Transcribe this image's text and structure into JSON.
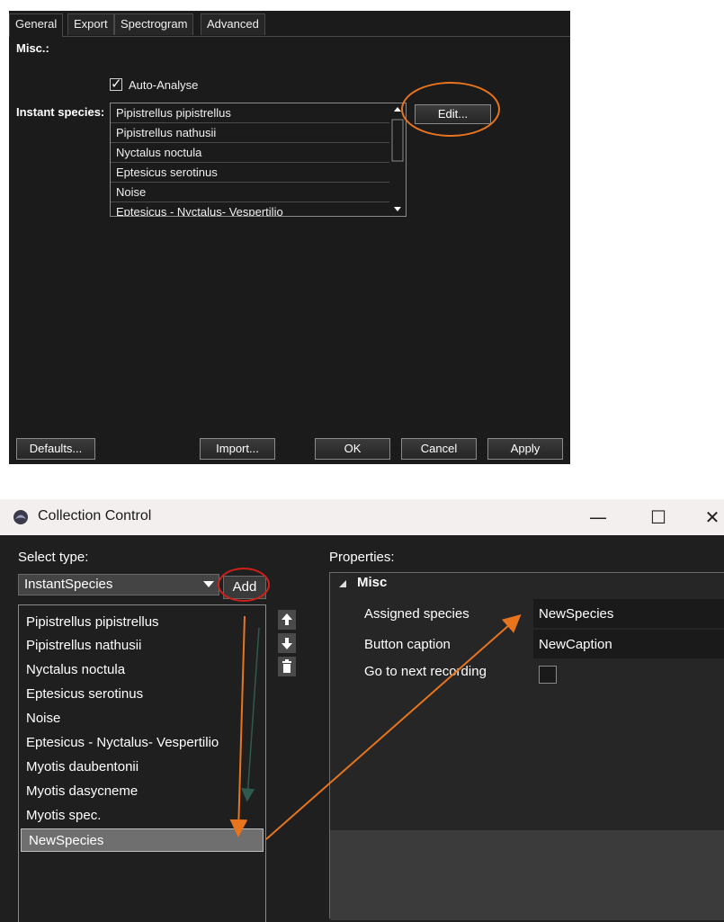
{
  "settings": {
    "tabs": [
      "General",
      "Export",
      "Spectrogram",
      "Advanced"
    ],
    "misc_label": "Misc.:",
    "auto_analyse": {
      "label": "Auto-Analyse",
      "checked": true
    },
    "instant_species_label": "Instant species:",
    "species": [
      "Pipistrellus pipistrellus",
      "Pipistrellus nathusii",
      "Nyctalus noctula",
      "Eptesicus serotinus",
      "Noise",
      "Eptesicus - Nyctalus- Vespertilio"
    ],
    "edit_button": "Edit...",
    "footer": {
      "defaults": "Defaults...",
      "import": "Import...",
      "ok": "OK",
      "cancel": "Cancel",
      "apply": "Apply"
    }
  },
  "collection": {
    "title": "Collection Control",
    "window_controls": {
      "minimize": "—",
      "maximize": "☐",
      "close": "✕"
    },
    "select_type_label": "Select type:",
    "type_value": "InstantSpecies",
    "add_button": "Add",
    "items": [
      "Pipistrellus pipistrellus",
      "Pipistrellus nathusii",
      "Nyctalus noctula",
      "Eptesicus serotinus",
      "Noise",
      "Eptesicus - Nyctalus- Vespertilio",
      "Myotis daubentonii",
      "Myotis dasycneme",
      "Myotis spec.",
      "NewSpecies"
    ],
    "selected_item": "NewSpecies",
    "properties_label": "Properties:",
    "category": "Misc",
    "properties": [
      {
        "name": "Assigned species",
        "value": "NewSpecies"
      },
      {
        "name": "Button caption",
        "value": "NewCaption"
      },
      {
        "name": "Go to next recording",
        "value": ""
      }
    ]
  },
  "colors": {
    "annotation_orange": "#e8741e",
    "annotation_red": "#d0201a",
    "window_bg": "#1b1b1b"
  },
  "icons": [
    "checkmark-icon",
    "scroll-up-arrow-icon",
    "scroll-down-arrow-icon",
    "dropdown-arrow-icon",
    "move-up-icon",
    "move-down-icon",
    "trash-icon",
    "collapse-triangle-icon",
    "app-icon"
  ]
}
